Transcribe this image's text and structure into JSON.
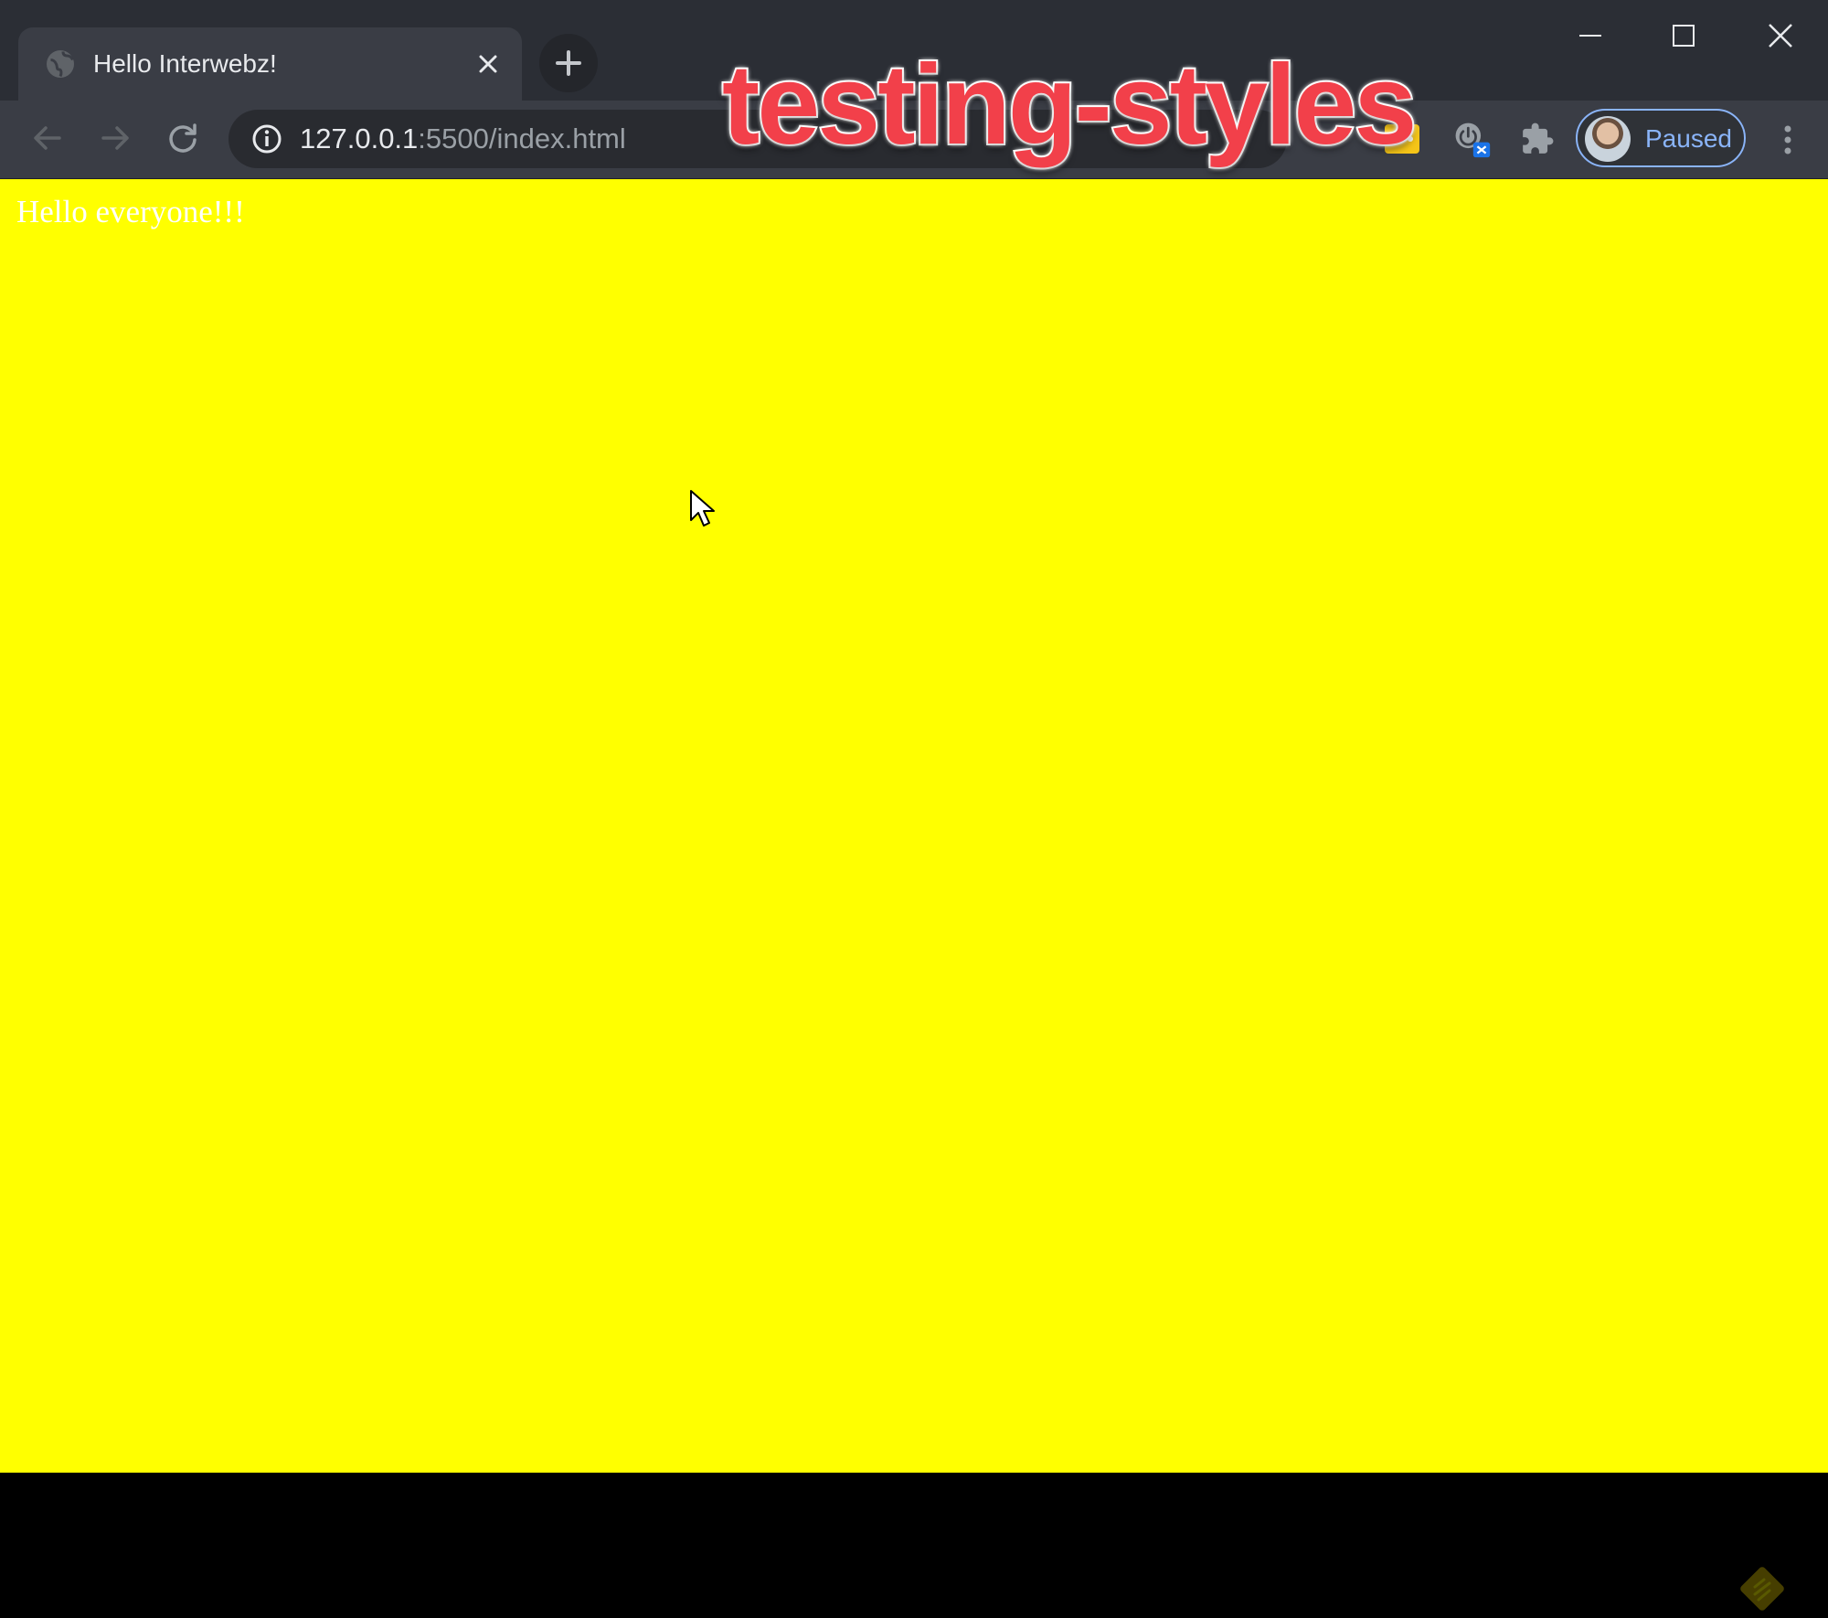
{
  "browser": {
    "tab": {
      "title": "Hello Interwebz!",
      "favicon": "globe-icon"
    },
    "window_controls": [
      "minimize-icon",
      "maximize-icon",
      "close-icon"
    ],
    "address_bar": {
      "host": "127.0.0.1",
      "path": ":5500/index.html",
      "info_icon": "info-icon"
    },
    "extensions": [
      "password-manager-icon",
      "power-extension-icon",
      "puzzle-icon"
    ],
    "profile": {
      "label": "Paused"
    },
    "colors": {
      "frame": "#2b2e35",
      "toolbar": "#3a3d45",
      "profile_accent": "#8ab4f8"
    }
  },
  "overlay": {
    "caption": "testing-styles",
    "color": "#f2404a"
  },
  "page": {
    "heading_text": "Hello everyone!!!",
    "background_color": "#ffff00",
    "text_color": "#ffffff"
  }
}
